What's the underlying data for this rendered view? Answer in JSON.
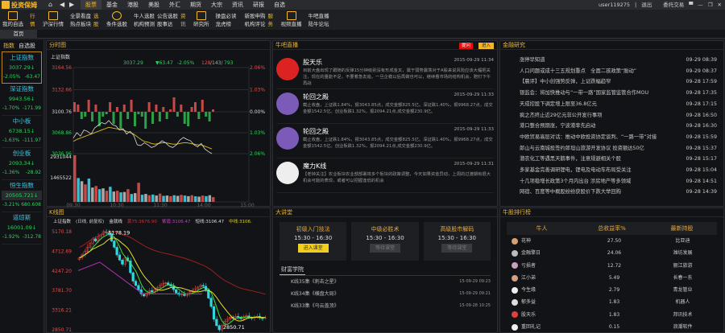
{
  "app": {
    "logo": "投资保姆",
    "nav": [
      "股票",
      "基金",
      "港股",
      "美股",
      "外汇",
      "期货",
      "大宗",
      "资讯",
      "研报",
      "自选"
    ],
    "active_nav": 0,
    "user": "user119275",
    "logout": "退出",
    "trade": "委托交易"
  },
  "toolbar": {
    "my_watch": "我的自选",
    "hq_v": [
      "行",
      "情"
    ],
    "hs": "沪深行情",
    "g1": [
      "全景看盘",
      "热点板块"
    ],
    "xg_v": [
      "选",
      "股"
    ],
    "cond": "条件选股",
    "g2": [
      "牛人选股",
      "机构预测"
    ],
    "g3": [
      "公告选股",
      "股事达"
    ],
    "zx_v": [
      "资",
      "讯"
    ],
    "research": "研究所",
    "g4": [
      "操盘必读",
      "龙虎榜"
    ],
    "g5": [
      "新股申购",
      "机构评论"
    ],
    "fw_v": [
      "服",
      "务"
    ],
    "video": "视频直播",
    "g6": [
      "牛吧直播",
      "陆牛论坛"
    ]
  },
  "page_tab": "首页",
  "sidebar": {
    "tabs": [
      "指数",
      "自选股"
    ],
    "items": [
      {
        "name": "上证指数",
        "value": "3037.29↓",
        "pct": "-2.05%",
        "chg": "-63.47"
      },
      {
        "name": "深证指数",
        "value": "9943.56↓",
        "pct": "-1.70%",
        "chg": "-171.99"
      },
      {
        "name": "中小板",
        "value": "6738.15↓",
        "pct": "-1.63%",
        "chg": "-111.97"
      },
      {
        "name": "创业板",
        "value": "2093.34↓",
        "pct": "-1.36%",
        "chg": "-28.92"
      },
      {
        "name": "恒生指数",
        "value": "20505.721↓",
        "pct": "-3.21%",
        "chg": "680.608"
      },
      {
        "name": "道琼斯",
        "value": "16001.09↓",
        "pct": "-1.92%",
        "chg": "-312.78"
      }
    ]
  },
  "intraday": {
    "title": "分时图",
    "name": "上证指数",
    "price": "3037.29",
    "change": "▼63.47",
    "pct": "-2.05%",
    "breadth": "128",
    "breadth2": "/143/",
    "breadth3": "793",
    "y_left": [
      "3164.56",
      "3132.66",
      "3100.76",
      "3068.86",
      "3036.96"
    ],
    "y_right": [
      "2.06%",
      "1.03%",
      "0.00%",
      "1.03%",
      "2.06%"
    ],
    "vol_labels": [
      "2931044",
      "1465522"
    ],
    "x_ticks": [
      "09:30",
      "10:30",
      "11:30",
      "14:00",
      "15:00"
    ]
  },
  "kline": {
    "title": "K线图",
    "name": "上证指数",
    "mode": "(日线, 前复权)",
    "ma_label": "金就线",
    "ma1": "黄75:3676.90",
    "ma2": "紫霞:3106.47",
    "ma3": "短线:3106.47",
    "ma4": "中线:3106.",
    "y": [
      "5170.18",
      "4712.69",
      "4247.20",
      "3781.70",
      "3316.21",
      "2850.71"
    ],
    "hi": "5178.19",
    "lo": "2850.71"
  },
  "chart_data": [
    {
      "type": "line",
      "title": "分时图",
      "ylim": [
        3036.96,
        3164.56
      ],
      "price": [
        3060,
        3068,
        3063,
        3072,
        3070,
        3066,
        3075,
        3079,
        3083,
        3081,
        3086,
        3080,
        3078,
        3072,
        3074,
        3066,
        3070,
        3064,
        3050,
        3049,
        3053,
        3050,
        3046,
        3048,
        3052,
        3056,
        3053,
        3048,
        3046,
        3050,
        3057,
        3061,
        3058,
        3056,
        3050,
        3047,
        3052,
        3044,
        3040,
        3037
      ],
      "avg": [
        3055,
        3058,
        3060,
        3062,
        3064,
        3066,
        3068,
        3070,
        3072,
        3074,
        3076,
        3075,
        3074,
        3073,
        3072,
        3070,
        3068,
        3066,
        3062,
        3058,
        3055,
        3054,
        3052,
        3051,
        3052,
        3053,
        3053,
        3052,
        3051,
        3051,
        3052,
        3053,
        3053,
        3052,
        3051,
        3050,
        3050,
        3048,
        3046,
        3044
      ],
      "diff": [
        4,
        3,
        -3,
        -2,
        5,
        -4,
        3,
        -6,
        -2,
        -1,
        4,
        -5,
        2,
        -7,
        3,
        -3,
        5,
        -6,
        -1,
        -2,
        -7,
        4,
        -5,
        3,
        -4,
        2,
        -3,
        1,
        6,
        -2,
        3,
        -5,
        -6,
        2,
        4,
        -3,
        5,
        -2,
        -4,
        1
      ],
      "volume": [
        2931044,
        1500000,
        1300000,
        1100000,
        1465522,
        900000,
        1000000,
        800000,
        850000,
        700000,
        950000,
        650000,
        700000,
        600000,
        620000,
        800000,
        500000,
        550000,
        1200000,
        450000,
        500000,
        420000,
        460000,
        400000,
        520000,
        380000,
        400000,
        360000,
        420000,
        380000,
        440000,
        400000,
        360000,
        420000,
        350000,
        330000,
        400000,
        360000,
        420000,
        300000
      ]
    },
    {
      "type": "candlestick",
      "title": "K线图",
      "ylim": [
        2850.71,
        5170.18
      ],
      "close": [
        4550,
        4620,
        4700,
        4800,
        4900,
        5000,
        4950,
        5060,
        5100,
        5170,
        5140,
        5120,
        4950,
        4800,
        4620,
        4500,
        4400,
        4550,
        4480,
        4200,
        4000,
        3900,
        3800,
        3700,
        3650,
        3720,
        3780,
        3750,
        3800,
        3850,
        3900,
        3950,
        3960,
        3920,
        3880,
        3800,
        3720,
        3680,
        3700,
        3660,
        3700,
        3750,
        3780,
        3820,
        3860,
        3900,
        3880,
        3800,
        3600,
        3400,
        3100,
        2950,
        2850,
        2950,
        3050,
        3100,
        3150,
        3120,
        3170,
        3150,
        3110,
        3160,
        3180,
        3140,
        3120,
        3150,
        3170,
        3130,
        3120,
        3140
      ]
    }
  ],
  "live": {
    "title": "牛吧直播",
    "btn_ask": "提问",
    "btn_enter": "进入",
    "posts": [
      {
        "user": "股天乐",
        "time": "2015-09-29 11:34",
        "text": "目前大盘出现了跟随的反弹15分钟级别没有形成金叉，属于弱势震荡对于A股来说风险应该大幅把关注，现在的量能不足，不要着急去追，一旦企稳以后再做也可以，继续看市场的结构机会，赔钉下午再战",
        "color": "#d22"
      },
      {
        "user": "轮回之殿",
        "time": "2015-09-29 11:33",
        "text": "截止收盘，上证跌1.84%，报3043.85点，成交金额825.5亿。深证跌1.40%，报9968.27点，成交金额1542.5亿。创业板跌1.32%，报2094.21点,成交金额230.9亿。",
        "color": "#7b5ab8"
      },
      {
        "user": "轮回之殿",
        "time": "2015-09-29 11:33",
        "text": "截止收盘，上证跌1.84%，报3043.85点，成交金额825.5亿。深证跌1.40%，报9968.27点，成交金额1542.5亿。创业板跌1.32%，报2094.21点,成交金额230.9亿。",
        "color": "#7b5ab8"
      },
      {
        "user": "魔力K线",
        "time": "2015-09-29 11:31",
        "text": "【老钟关注】农业板块农业部部署将多个板块的政策调整，今天如果资金异动，上周的过渡期有很大机会可能的表现，或者可以把握逢低的机会",
        "color": "#eee"
      }
    ]
  },
  "research": {
    "title": "金融研究",
    "items": [
      {
        "t": "涨停早知道",
        "d": "09-29 08:39"
      },
      {
        "t": "人口问题或成十三五规划重点　全面二孩政策“胎动”",
        "d": "09-29 08:37"
      },
      {
        "t": "【晨评】中小创强势反弹，上证跌幅趋窄",
        "d": "09-28 17:59"
      },
      {
        "t": "银监会：将加快推动与“一带一路”国家监管监管合作MOU",
        "d": "09-28 17:35"
      },
      {
        "t": "天成控股下调定增上限至36.8亿元",
        "d": "09-28 17:15"
      },
      {
        "t": "疯之杰终止近29亿元非公开发行事项",
        "d": "09-28 16:50"
      },
      {
        "t": "港口整合预期涨，宁波港率先启动",
        "d": "09-28 16:30"
      },
      {
        "t": "中欧贸易高层对话：推动中欧投资协定谈判、“一路一带”对接",
        "d": "09-28 15:59"
      },
      {
        "t": "郎山与云南城投签约郎坦山旅游开发协议 投资额达50亿",
        "d": "09-28 15:37"
      },
      {
        "t": "潜农化工等遇黑天鹅事件，注意规避相关个股",
        "d": "09-28 15:17"
      },
      {
        "t": "多家基金完善调研锂电，锂电及电动车布局受关注",
        "d": "09-28 15:04"
      },
      {
        "t": "十几项稳增长政策3个月内出台 涉房地产等多领域",
        "d": "09-28 14:51"
      },
      {
        "t": "网宿、百度等中概股纷纷获股价下跌大举回购",
        "d": "09-28 14:39"
      }
    ]
  },
  "classroom": {
    "title": "大讲堂",
    "classes": [
      {
        "name": "初级入门技法",
        "time": "15:30 - 16:30",
        "btn": "进入课堂"
      },
      {
        "name": "中级必胜术",
        "time": "15:30 - 16:30",
        "btn": "等待课堂"
      },
      {
        "name": "高级股市解码",
        "time": "15:30 - 16:30",
        "btn": "等待课堂"
      }
    ],
    "college": "财富学院",
    "items": [
      {
        "t": "K线35集《刺击之星》",
        "d": "15-09-29 09:23"
      },
      {
        "t": "K线34集《横盘大局》",
        "d": "15-09-29 09:21"
      },
      {
        "t": "K线33集《乌云盖顶》",
        "d": "15-09-28 10:25"
      }
    ]
  },
  "ranking": {
    "title": "牛股排行榜",
    "headers": [
      "牛人",
      "总收益率%",
      "最新持股"
    ],
    "rows": [
      {
        "n": "花神",
        "r": "27.50",
        "s": "比亚迪"
      },
      {
        "n": "金融擎日",
        "r": "24.06",
        "s": "潍坊发展"
      },
      {
        "n": "亏损者",
        "r": "12.72",
        "s": "丽江旅游"
      },
      {
        "n": "江小弟",
        "r": "5.49",
        "s": "长春一东"
      },
      {
        "n": "今生缘",
        "r": "2.79",
        "s": "青龙管业"
      },
      {
        "n": "郁多益",
        "r": "1.83",
        "s": "机器人"
      },
      {
        "n": "股天乐",
        "r": "1.83",
        "s": "邦讯技术"
      },
      {
        "n": "重回礼记",
        "r": "0.15",
        "s": "浪潮软件"
      }
    ]
  }
}
